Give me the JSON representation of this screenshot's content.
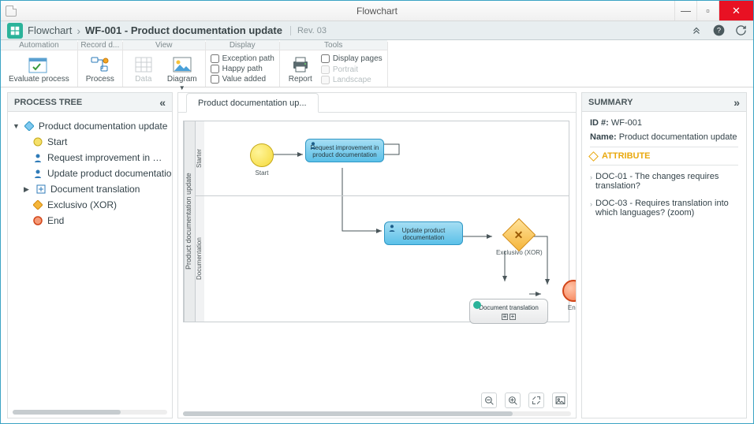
{
  "window": {
    "title": "Flowchart"
  },
  "breadcrumb": {
    "app": "Flowchart",
    "title": "WF-001 - Product documentation update",
    "rev": "Rev. 03"
  },
  "ribbon": {
    "groups": {
      "automation": {
        "title": "Automation",
        "evaluate": "Evaluate process"
      },
      "record": {
        "title": "Record d...",
        "process": "Process"
      },
      "view": {
        "title": "View",
        "data": "Data",
        "diagram": "Diagram"
      },
      "display": {
        "title": "Display",
        "exception": "Exception path",
        "happy": "Happy path",
        "value": "Value added"
      },
      "tools": {
        "title": "Tools",
        "report": "Report",
        "pages": "Display pages",
        "portrait": "Portrait",
        "landscape": "Landscape"
      }
    }
  },
  "tree": {
    "title": "PROCESS TREE",
    "root": "Product documentation update",
    "n_start": "Start",
    "n_request": "Request improvement in product documentation",
    "n_update": "Update product documentation",
    "n_doctrans": "Document translation",
    "n_xor": "Exclusivo (XOR)",
    "n_end": "End"
  },
  "canvas": {
    "tab": "Product documentation up...",
    "pool": "Product documentation update",
    "lane_starter": "Starter",
    "lane_doc": "Documentation",
    "start_lbl": "Start",
    "task_request": "Request improvement in product documentation",
    "task_update": "Update product documentation",
    "gateway_lbl": "Exclusivo (XOR)",
    "subproc": "Document translation",
    "end_lbl": "End"
  },
  "summary": {
    "title": "SUMMARY",
    "id_label": "ID #:",
    "id_val": "WF-001",
    "name_label": "Name:",
    "name_val": "Product documentation update",
    "attr_head": "ATTRIBUTE",
    "attr1": "DOC-01 - The changes requires translation?",
    "attr2": "DOC-03 - Requires translation into which languages? (zoom)"
  }
}
